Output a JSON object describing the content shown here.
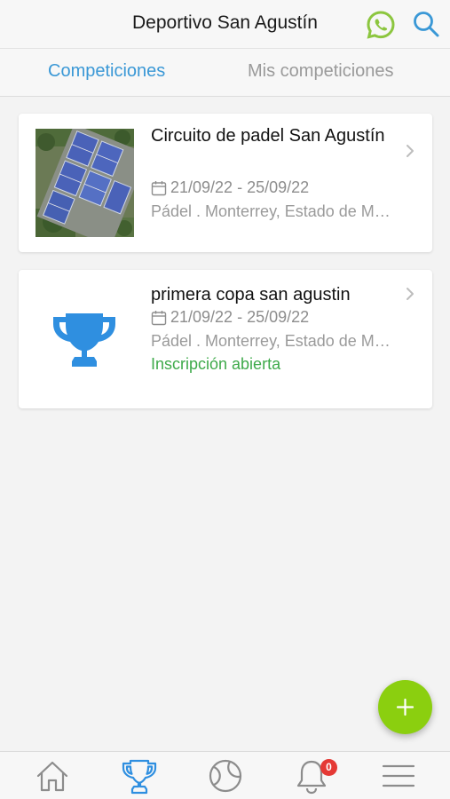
{
  "header": {
    "title": "Deportivo San Agustín",
    "whatsapp_icon": "whatsapp-icon",
    "search_icon": "search-icon",
    "whatsapp_color": "#8cc63f",
    "search_color": "#3a98d6"
  },
  "tabs": [
    {
      "label": "Competiciones",
      "active": true
    },
    {
      "label": "Mis competiciones",
      "active": false
    }
  ],
  "competitions": [
    {
      "title": "Circuito de padel San Agustín",
      "dates": "21/09/22 - 25/09/22",
      "location": "Pádel . Monterrey, Estado de México",
      "status": "",
      "image": "aerial-padel-courts-photo"
    },
    {
      "title": "primera copa san agustin",
      "dates": "21/09/22 - 25/09/22",
      "location": "Pádel . Monterrey, Estado de México",
      "status": "Inscripción abierta",
      "image": "trophy-icon"
    }
  ],
  "fab": {
    "icon": "plus-icon",
    "color": "#8bcf0f"
  },
  "bottom_nav": [
    {
      "icon": "home-icon",
      "active": false
    },
    {
      "icon": "trophy-icon",
      "active": true
    },
    {
      "icon": "tennis-ball-icon",
      "active": false
    },
    {
      "icon": "bell-icon",
      "active": false,
      "badge": "0"
    },
    {
      "icon": "menu-icon",
      "active": false
    }
  ],
  "colors": {
    "accent": "#3a98d6",
    "inactive": "#9a9a9a",
    "open_status": "#3eaa4a",
    "badge": "#e53935"
  }
}
